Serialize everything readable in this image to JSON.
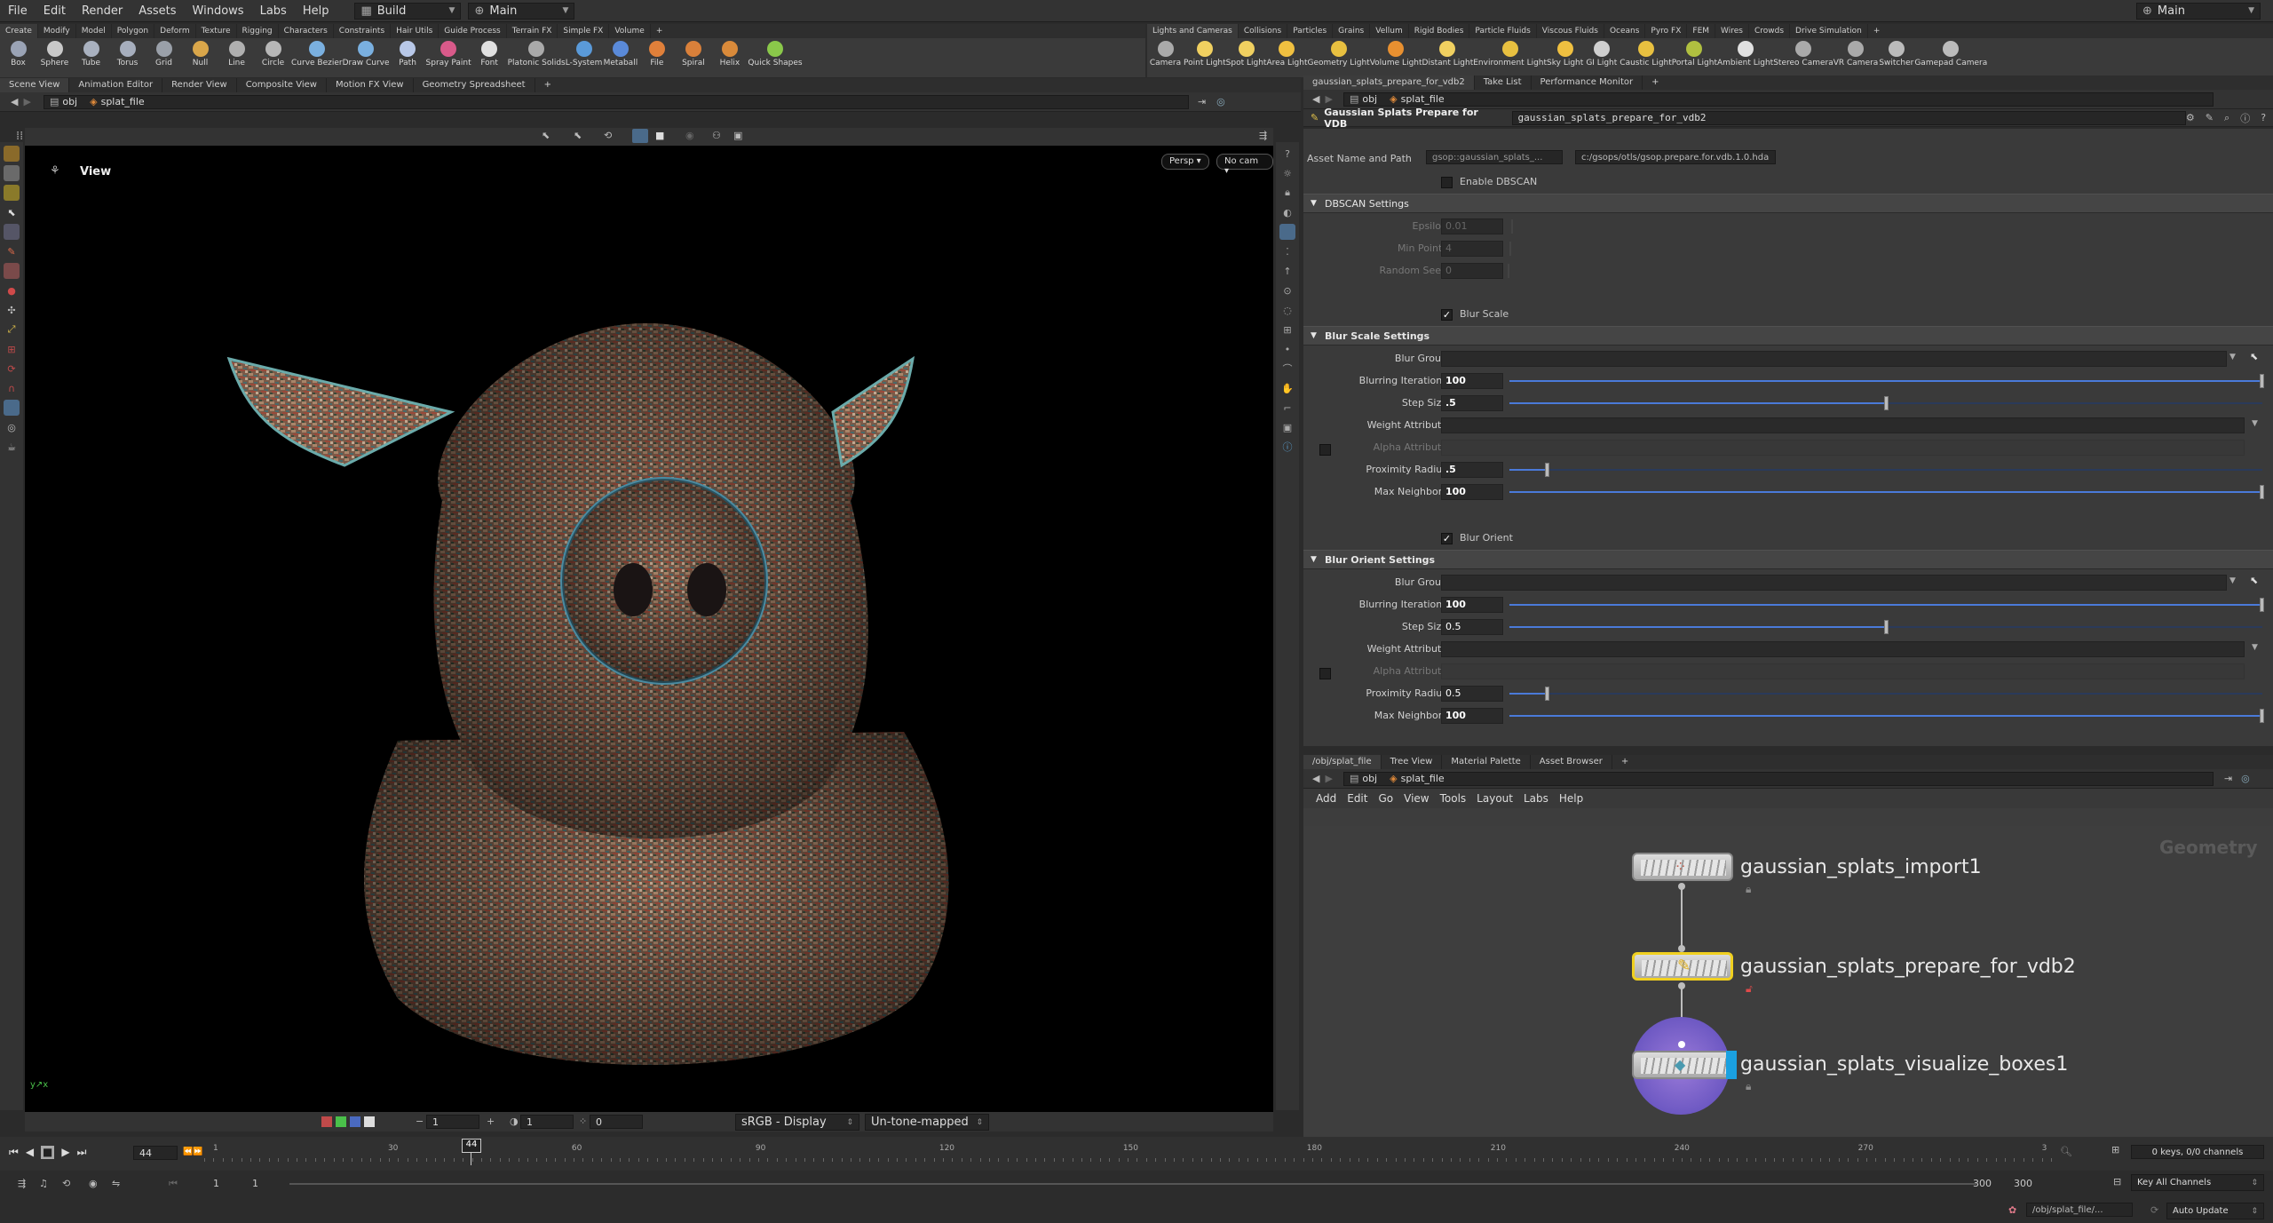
{
  "menubar": {
    "items": [
      "File",
      "Edit",
      "Render",
      "Assets",
      "Windows",
      "Labs",
      "Help"
    ],
    "desktop": "Build",
    "context": "Main",
    "right_context": "Main"
  },
  "shelf_left": {
    "tabs": [
      "Create",
      "Modify",
      "Model",
      "Polygon",
      "Deform",
      "Texture",
      "Rigging",
      "Characters",
      "Constraints",
      "Hair Utils",
      "Guide Process",
      "Terrain FX",
      "Simple FX",
      "Volume"
    ],
    "tools": [
      {
        "label": "Box",
        "color": "#9aa3b5"
      },
      {
        "label": "Sphere",
        "color": "#c9c9c9"
      },
      {
        "label": "Tube",
        "color": "#a9b1bf"
      },
      {
        "label": "Torus",
        "color": "#a6aebd"
      },
      {
        "label": "Grid",
        "color": "#9aa0a9"
      },
      {
        "label": "Null",
        "color": "#d9a64a"
      },
      {
        "label": "Line",
        "color": "#b0b0b0"
      },
      {
        "label": "Circle",
        "color": "#b7b7b7"
      },
      {
        "label": "Curve Bezier",
        "color": "#7ab0e0"
      },
      {
        "label": "Draw Curve",
        "color": "#7ab0e0"
      },
      {
        "label": "Path",
        "color": "#b8c8e8"
      },
      {
        "label": "Spray Paint",
        "color": "#d95a8a"
      },
      {
        "label": "Font",
        "color": "#e0e0e0"
      },
      {
        "label": "Platonic Solids",
        "color": "#aaa"
      },
      {
        "label": "L-System",
        "color": "#5a9ad9"
      },
      {
        "label": "Metaball",
        "color": "#5a8ad9"
      },
      {
        "label": "File",
        "color": "#e0803a"
      },
      {
        "label": "Spiral",
        "color": "#d9803a"
      },
      {
        "label": "Helix",
        "color": "#d98a3a"
      },
      {
        "label": "Quick Shapes",
        "color": "#8ac84a"
      }
    ]
  },
  "shelf_right": {
    "tabs": [
      "Lights and Cameras",
      "Collisions",
      "Particles",
      "Grains",
      "Vellum",
      "Rigid Bodies",
      "Particle Fluids",
      "Viscous Fluids",
      "Oceans",
      "Pyro FX",
      "FEM",
      "Wires",
      "Crowds",
      "Drive Simulation"
    ],
    "tools": [
      {
        "label": "Camera",
        "color": "#aaa"
      },
      {
        "label": "Point Light",
        "color": "#f0d060"
      },
      {
        "label": "Spot Light",
        "color": "#f0d060"
      },
      {
        "label": "Area Light",
        "color": "#f0c040"
      },
      {
        "label": "Geometry Light",
        "color": "#e8c040"
      },
      {
        "label": "Volume Light",
        "color": "#e89030"
      },
      {
        "label": "Distant Light",
        "color": "#f0d060"
      },
      {
        "label": "Environment Light",
        "color": "#e8c040"
      },
      {
        "label": "Sky Light",
        "color": "#f0c040"
      },
      {
        "label": "GI Light",
        "color": "#d0d0d0"
      },
      {
        "label": "Caustic Light",
        "color": "#e8c040"
      },
      {
        "label": "Portal Light",
        "color": "#b0c040"
      },
      {
        "label": "Ambient Light",
        "color": "#e0e0e0"
      },
      {
        "label": "Stereo Camera",
        "color": "#aaa"
      },
      {
        "label": "VR Camera",
        "color": "#aaa"
      },
      {
        "label": "Switcher",
        "color": "#bbb"
      },
      {
        "label": "Gamepad Camera",
        "color": "#bbb"
      }
    ]
  },
  "left_panel": {
    "tabs": [
      "Scene View",
      "Animation Editor",
      "Render View",
      "Composite View",
      "Motion FX View",
      "Geometry Spreadsheet"
    ],
    "path_root": "obj",
    "path_node": "splat_file",
    "viewport_title": "View",
    "persp": "Persp",
    "cam": "No cam",
    "bottom": {
      "frame_a": "1",
      "frame_b": "1",
      "frame_c": "0",
      "colorspace": "sRGB - Display",
      "tonemap": "Un-tone-mapped"
    }
  },
  "param_panel": {
    "tabs": [
      "gaussian_splats_prepare_for_vdb2",
      "Take List",
      "Performance Monitor"
    ],
    "path_root": "obj",
    "path_node": "splat_file",
    "node_type": "Gaussian Splats Prepare for VDB",
    "node_name": "gaussian_splats_prepare_for_vdb2",
    "asset_label": "Asset Name and Path",
    "asset_name": "gsop::gaussian_splats_...",
    "asset_path": "c:/gsops/otls/gsop.prepare.for.vdb.1.0.hda",
    "enable_dbscan": "Enable DBSCAN",
    "dbscan": {
      "title": "DBSCAN Settings",
      "epsilon_label": "Epsilon",
      "epsilon": "0.01",
      "minpts_label": "Min Points",
      "minpts": "4",
      "seed_label": "Random Seed",
      "seed": "0"
    },
    "blur_scale_toggle": "Blur Scale",
    "blur_scale": {
      "title": "Blur Scale Settings",
      "group_label": "Blur Group",
      "iter_label": "Blurring Iterations",
      "iter": "100",
      "step_label": "Step Size",
      "step": ".5",
      "weight_label": "Weight Attribute",
      "alpha_label": "Alpha Attribute",
      "radius_label": "Proximity Radius",
      "radius": ".5",
      "neighbors_label": "Max Neighbors",
      "neighbors": "100"
    },
    "blur_orient_toggle": "Blur Orient",
    "blur_orient": {
      "title": "Blur Orient Settings",
      "group_label": "Blur Group",
      "iter_label": "Blurring Iterations",
      "iter": "100",
      "step_label": "Step Size",
      "step": "0.5",
      "weight_label": "Weight Attribute",
      "alpha_label": "Alpha Attribute",
      "radius_label": "Proximity Radius",
      "radius": "0.5",
      "neighbors_label": "Max Neighbors",
      "neighbors": "100"
    }
  },
  "network_panel": {
    "tabs": [
      "/obj/splat_file",
      "Tree View",
      "Material Palette",
      "Asset Browser"
    ],
    "path_root": "obj",
    "path_node": "splat_file",
    "menu": [
      "Add",
      "Edit",
      "Go",
      "View",
      "Tools",
      "Layout",
      "Labs",
      "Help"
    ],
    "context_label": "Geometry",
    "nodes": [
      {
        "name": "gaussian_splats_import1"
      },
      {
        "name": "gaussian_splats_prepare_for_vdb2"
      },
      {
        "name": "gaussian_splats_visualize_boxes1"
      }
    ]
  },
  "timeline": {
    "current_frame": "44",
    "marker": "44",
    "ticks": [
      "1",
      "30",
      "60",
      "90",
      "120",
      "150",
      "180",
      "210",
      "240",
      "270",
      "3"
    ],
    "start_a": "1",
    "start_b": "1",
    "end_a": "300",
    "end_b": "300",
    "keys": "0 keys, 0/0 channels",
    "key_mode": "Key All Channels"
  },
  "status": {
    "path": "/obj/splat_file/...",
    "update": "Auto Update"
  },
  "colors": {
    "accent": "#4a7ad9",
    "selected_node": "#f0d020",
    "display_flag": "#1aa0e0"
  }
}
